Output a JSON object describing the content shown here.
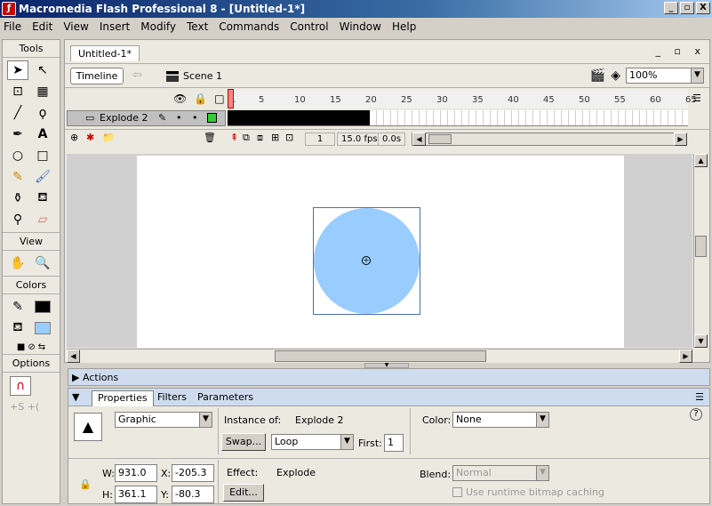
{
  "window": {
    "title": "Macromedia Flash Professional 8 - [Untitled-1*]",
    "controls": [
      "_",
      "▫",
      "X"
    ]
  },
  "menu": [
    "File",
    "Edit",
    "View",
    "Insert",
    "Modify",
    "Text",
    "Commands",
    "Control",
    "Window",
    "Help"
  ],
  "tools": {
    "header": "Tools",
    "view_label": "View",
    "colors_label": "Colors",
    "options_label": "Options",
    "stroke_color": "#000000",
    "fill_color": "#99ccff"
  },
  "document": {
    "tab": "Untitled-1*",
    "timeline_button": "Timeline",
    "scene": "Scene 1",
    "zoom": "100%"
  },
  "timeline": {
    "ruler_ticks": [
      "1",
      "5",
      "10",
      "15",
      "20",
      "25",
      "30",
      "35",
      "40",
      "45",
      "50",
      "55",
      "60",
      "65"
    ],
    "layer_name": "Explode 2",
    "current_frame": "1",
    "fps": "15.0 fps",
    "elapsed": "0.0s",
    "filled_frames": 20
  },
  "stage": {
    "shape_color": "#99ccff"
  },
  "actions_panel": {
    "title": "Actions"
  },
  "properties": {
    "tabs": [
      "Properties",
      "Filters",
      "Parameters"
    ],
    "symbol_type": "Graphic",
    "instance_of_label": "Instance of:",
    "instance_of_value": "Explode 2",
    "swap_button": "Swap...",
    "loop_value": "Loop",
    "first_label": "First:",
    "first_value": "1",
    "color_label": "Color:",
    "color_value": "None",
    "w_label": "W:",
    "w_value": "931.0",
    "h_label": "H:",
    "h_value": "361.1",
    "x_label": "X:",
    "x_value": "-205.3",
    "y_label": "Y:",
    "y_value": "-80.3",
    "effect_label": "Effect:",
    "effect_value": "Explode",
    "edit_button": "Edit...",
    "blend_label": "Blend:",
    "blend_value": "Normal",
    "cache_label": "Use runtime bitmap caching"
  }
}
